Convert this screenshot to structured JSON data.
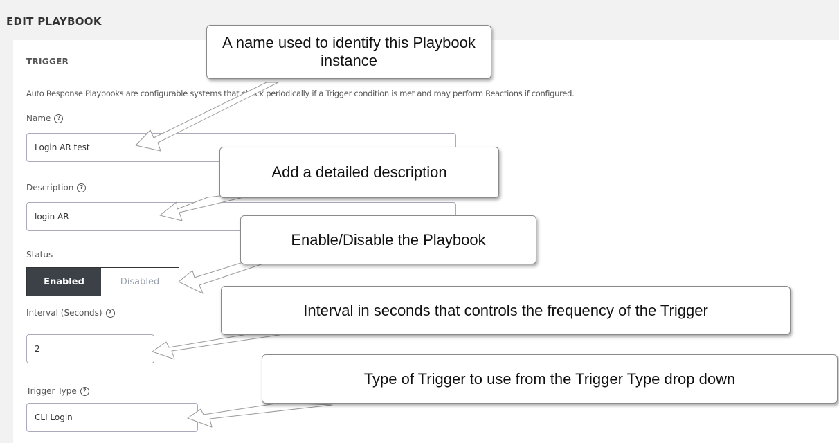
{
  "page": {
    "title": "EDIT PLAYBOOK"
  },
  "section": {
    "title": "TRIGGER",
    "intro": "Auto Response Playbooks are configurable systems that check periodically if a Trigger condition is met and may perform Reactions if configured."
  },
  "fields": {
    "name": {
      "label": "Name",
      "value": "Login AR test"
    },
    "description": {
      "label": "Description",
      "value": "login AR"
    },
    "status": {
      "label": "Status",
      "enabled_label": "Enabled",
      "disabled_label": "Disabled",
      "selected": "Enabled"
    },
    "interval": {
      "label": "Interval (Seconds)",
      "value": "2"
    },
    "trigger_type": {
      "label": "Trigger Type",
      "value": "CLI Login"
    }
  },
  "help_glyph": "?",
  "callouts": {
    "name": "A name used to identify this Playbook instance",
    "description": "Add a detailed description",
    "status": "Enable/Disable the Playbook",
    "interval": "Interval in seconds that controls the frequency of the Trigger",
    "trigger_type": "Type of Trigger to use from the Trigger Type drop down"
  },
  "colors": {
    "toggle_active_bg": "#3c4147",
    "toggle_inactive_text": "#9aa3ad"
  }
}
